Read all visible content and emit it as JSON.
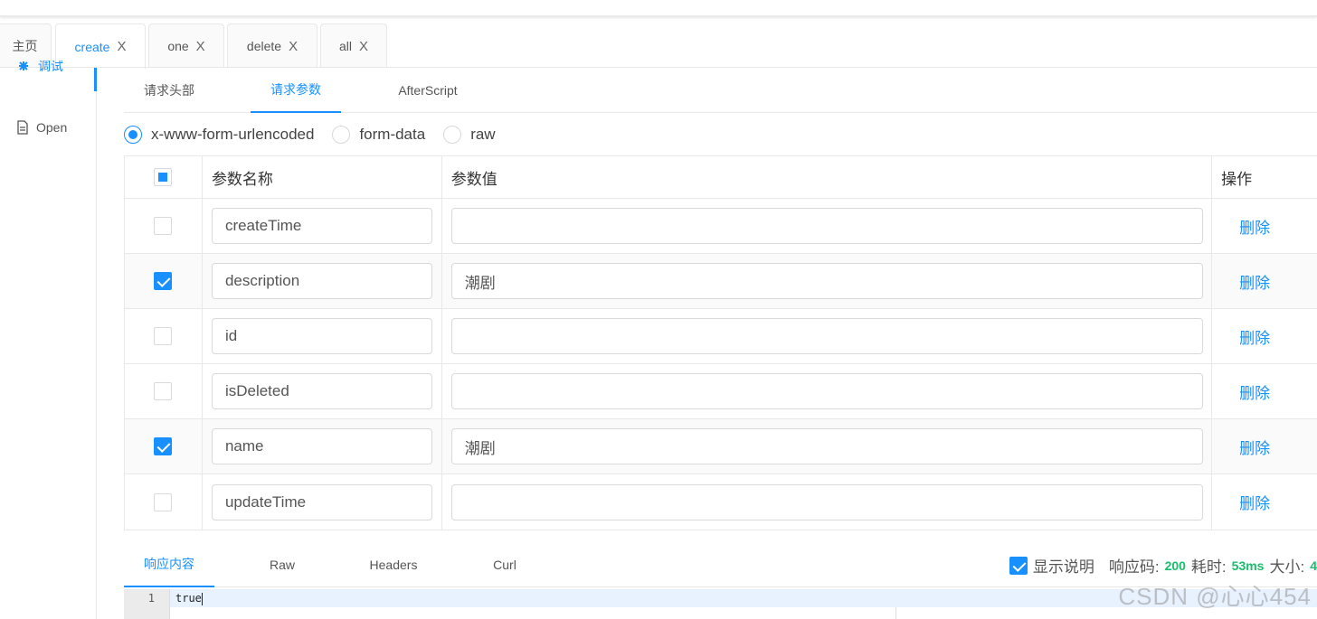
{
  "tabs": [
    {
      "label": "主页",
      "closable": false,
      "active": false
    },
    {
      "label": "create",
      "closable": true,
      "active": true
    },
    {
      "label": "one",
      "closable": true,
      "active": false
    },
    {
      "label": "delete",
      "closable": true,
      "active": false
    },
    {
      "label": "all",
      "closable": true,
      "active": false
    }
  ],
  "tab_close_glyph": "X",
  "sidebar": {
    "items": [
      {
        "label": "调试",
        "icon": "bug-icon"
      },
      {
        "label": "Open",
        "icon": "document-icon"
      }
    ]
  },
  "request_tabs": [
    "请求头部",
    "请求参数",
    "AfterScript"
  ],
  "body_types": [
    {
      "label": "x-www-form-urlencoded",
      "checked": true
    },
    {
      "label": "form-data",
      "checked": false
    },
    {
      "label": "raw",
      "checked": false
    }
  ],
  "params_table": {
    "headers": {
      "name": "参数名称",
      "value": "参数值",
      "action": "操作"
    },
    "rows": [
      {
        "checked": false,
        "name": "createTime",
        "value": "",
        "action": "删除"
      },
      {
        "checked": true,
        "name": "description",
        "value": "潮剧",
        "action": "删除"
      },
      {
        "checked": false,
        "name": "id",
        "value": "",
        "action": "删除"
      },
      {
        "checked": false,
        "name": "isDeleted",
        "value": "",
        "action": "删除"
      },
      {
        "checked": true,
        "name": "name",
        "value": "潮剧",
        "action": "删除"
      },
      {
        "checked": false,
        "name": "updateTime",
        "value": "",
        "action": "删除"
      }
    ]
  },
  "response": {
    "tabs": [
      "响应内容",
      "Raw",
      "Headers",
      "Curl"
    ],
    "show_desc_label": "显示说明",
    "show_desc_checked": true,
    "code_label": "响应码:",
    "code_value": "200",
    "time_label": "耗时:",
    "time_value": "53ms",
    "size_label": "大小:",
    "size_value": "4",
    "editor": {
      "line_number": "1",
      "content": "true"
    }
  },
  "watermark": "CSDN @心心454",
  "colors": {
    "accent": "#1890ff",
    "success": "#19be6b"
  }
}
